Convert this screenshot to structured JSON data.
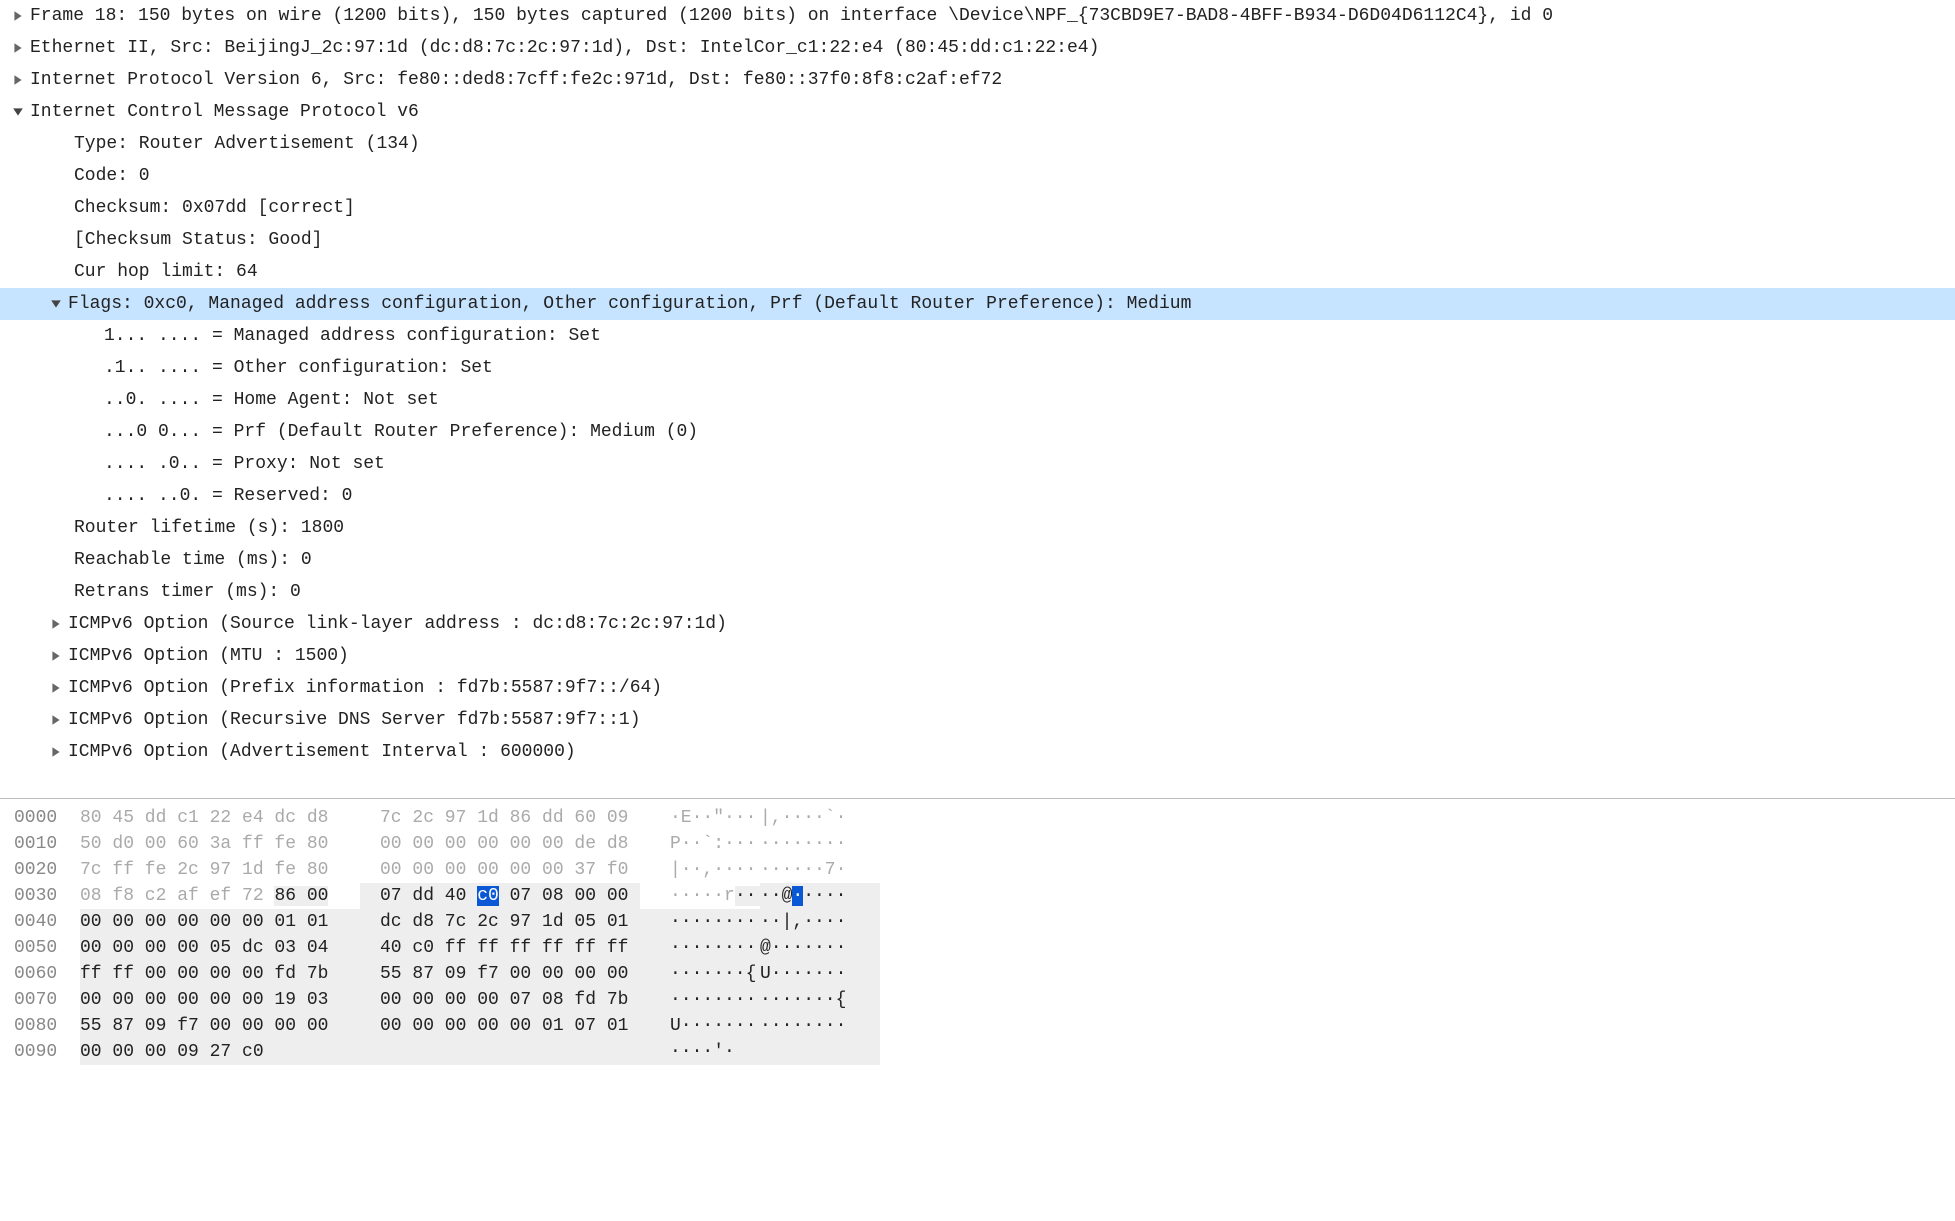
{
  "details": {
    "frame": "Frame 18: 150 bytes on wire (1200 bits), 150 bytes captured (1200 bits) on interface \\Device\\NPF_{73CBD9E7-BAD8-4BFF-B934-D6D04D6112C4}, id 0",
    "eth": "Ethernet II, Src: BeijingJ_2c:97:1d (dc:d8:7c:2c:97:1d), Dst: IntelCor_c1:22:e4 (80:45:dd:c1:22:e4)",
    "ipv6": "Internet Protocol Version 6, Src: fe80::ded8:7cff:fe2c:971d, Dst: fe80::37f0:8f8:c2af:ef72",
    "icmpv6_header": "Internet Control Message Protocol v6",
    "type": "Type: Router Advertisement (134)",
    "code": "Code: 0",
    "checksum": "Checksum: 0x07dd [correct]",
    "checksum_status": "[Checksum Status: Good]",
    "curhop": "Cur hop limit: 64",
    "flags": "Flags: 0xc0, Managed address configuration, Other configuration, Prf (Default Router Preference): Medium",
    "flag_m": "1... .... = Managed address configuration: Set",
    "flag_o": ".1.. .... = Other configuration: Set",
    "flag_h": "..0. .... = Home Agent: Not set",
    "flag_prf": "...0 0... = Prf (Default Router Preference): Medium (0)",
    "flag_p": ".... .0.. = Proxy: Not set",
    "flag_r": ".... ..0. = Reserved: 0",
    "router_lifetime": "Router lifetime (s): 1800",
    "reachable": "Reachable time (ms): 0",
    "retrans": "Retrans timer (ms): 0",
    "opt1": "ICMPv6 Option (Source link-layer address : dc:d8:7c:2c:97:1d)",
    "opt2": "ICMPv6 Option (MTU : 1500)",
    "opt3": "ICMPv6 Option (Prefix information : fd7b:5587:9f7::/64)",
    "opt4": "ICMPv6 Option (Recursive DNS Server fd7b:5587:9f7::1)",
    "opt5": "ICMPv6 Option (Advertisement Interval : 600000)"
  },
  "hex": {
    "rows": [
      {
        "off": "0000",
        "la": "80 45 dd c1 22 e4 dc d8",
        "ra": "7c 2c 97 1d 86 dd 60 09",
        "ascl": "·E··\"··· ",
        "ascr": "|,····`·",
        "dim": true,
        "field": false
      },
      {
        "off": "0010",
        "la": "50 d0 00 60 3a ff fe 80",
        "ra": "00 00 00 00 00 00 de d8",
        "ascl": "P··`:··· ",
        "ascr": "········",
        "dim": true,
        "field": false
      },
      {
        "off": "0020",
        "la": "7c ff fe 2c 97 1d fe 80",
        "ra": "00 00 00 00 00 00 37 f0",
        "ascl": "|··,···· ",
        "ascr": "······7·",
        "dim": true,
        "field": false
      },
      {
        "off": "0030",
        "la": "08 f8 c2 af ef 72 86 00",
        "ra_pre": "07 dd 40 ",
        "ra_sel": "c0",
        "ra_post": " 07 08 00 00",
        "ascl": "·····r·· ",
        "ascr_pre": "··@",
        "ascr_sel": "·",
        "ascr_post": "····",
        "dim": false,
        "field": true,
        "selrow": true
      },
      {
        "off": "0040",
        "la": "00 00 00 00 00 00 01 01",
        "ra": "dc d8 7c 2c 97 1d 05 01",
        "ascl": "········ ",
        "ascr": "··|,····",
        "dim": false,
        "field": true
      },
      {
        "off": "0050",
        "la": "00 00 00 00 05 dc 03 04",
        "ra": "40 c0 ff ff ff ff ff ff",
        "ascl": "········ ",
        "ascr": "@·······",
        "dim": false,
        "field": true
      },
      {
        "off": "0060",
        "la": "ff ff 00 00 00 00 fd 7b",
        "ra": "55 87 09 f7 00 00 00 00",
        "ascl": "·······{ ",
        "ascr": "U·······",
        "dim": false,
        "field": true
      },
      {
        "off": "0070",
        "la": "00 00 00 00 00 00 19 03",
        "ra": "00 00 00 00 07 08 fd 7b",
        "ascl": "········ ",
        "ascr": "·······{",
        "dim": false,
        "field": true
      },
      {
        "off": "0080",
        "la": "55 87 09 f7 00 00 00 00",
        "ra": "00 00 00 00 00 01 07 01",
        "ascl": "U······· ",
        "ascr": "········",
        "dim": false,
        "field": true
      },
      {
        "off": "0090",
        "la": "00 00 00 09 27 c0",
        "ra": "",
        "ascl": "····'·",
        "ascr": "",
        "dim": false,
        "field": true
      }
    ]
  }
}
